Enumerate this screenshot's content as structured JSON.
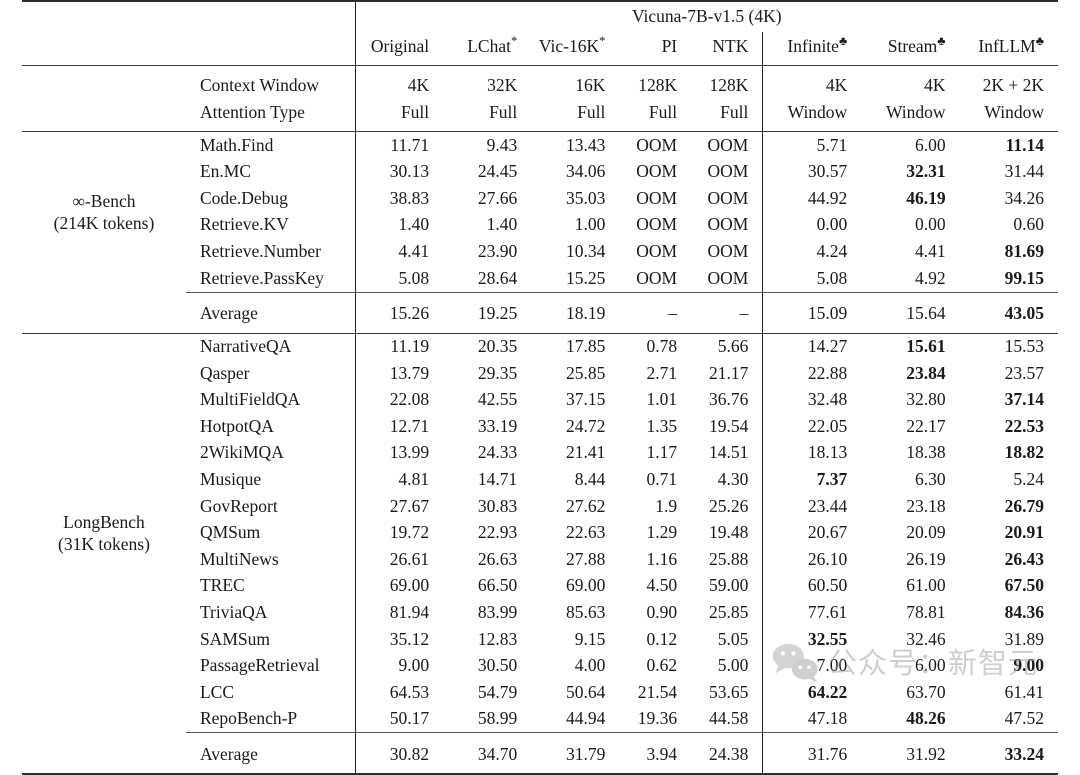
{
  "table": {
    "model_header": "Vicuna-7B-v1.5 (4K)",
    "methods": [
      {
        "label": "Original",
        "mark": ""
      },
      {
        "label": "LChat",
        "mark": "*"
      },
      {
        "label": "Vic-16K",
        "mark": "*"
      },
      {
        "label": "PI",
        "mark": ""
      },
      {
        "label": "NTK",
        "mark": ""
      },
      {
        "label": "Infinite",
        "mark": "♣"
      },
      {
        "label": "Stream",
        "mark": "♣"
      },
      {
        "label": "InfLLM",
        "mark": "♣"
      }
    ],
    "meta_rows": [
      {
        "label": "Context Window",
        "values": [
          "4K",
          "32K",
          "16K",
          "128K",
          "128K",
          "4K",
          "4K",
          "2K + 2K"
        ]
      },
      {
        "label": "Attention Type",
        "values": [
          "Full",
          "Full",
          "Full",
          "Full",
          "Full",
          "Window",
          "Window",
          "Window"
        ]
      }
    ],
    "sections": [
      {
        "group_name": "∞-Bench",
        "group_sub": "(214K tokens)",
        "rows": [
          {
            "task": "Math.Find",
            "values": [
              "11.71",
              "9.43",
              "13.43",
              "OOM",
              "OOM",
              "5.71",
              "6.00",
              "11.14"
            ],
            "bold": [
              false,
              false,
              false,
              false,
              false,
              false,
              false,
              true
            ]
          },
          {
            "task": "En.MC",
            "values": [
              "30.13",
              "24.45",
              "34.06",
              "OOM",
              "OOM",
              "30.57",
              "32.31",
              "31.44"
            ],
            "bold": [
              false,
              false,
              false,
              false,
              false,
              false,
              true,
              false
            ]
          },
          {
            "task": "Code.Debug",
            "values": [
              "38.83",
              "27.66",
              "35.03",
              "OOM",
              "OOM",
              "44.92",
              "46.19",
              "34.26"
            ],
            "bold": [
              false,
              false,
              false,
              false,
              false,
              false,
              true,
              false
            ]
          },
          {
            "task": "Retrieve.KV",
            "values": [
              "1.40",
              "1.40",
              "1.00",
              "OOM",
              "OOM",
              "0.00",
              "0.00",
              "0.60"
            ],
            "bold": [
              false,
              false,
              false,
              false,
              false,
              false,
              false,
              false
            ]
          },
          {
            "task": "Retrieve.Number",
            "values": [
              "4.41",
              "23.90",
              "10.34",
              "OOM",
              "OOM",
              "4.24",
              "4.41",
              "81.69"
            ],
            "bold": [
              false,
              false,
              false,
              false,
              false,
              false,
              false,
              true
            ]
          },
          {
            "task": "Retrieve.PassKey",
            "values": [
              "5.08",
              "28.64",
              "15.25",
              "OOM",
              "OOM",
              "5.08",
              "4.92",
              "99.15"
            ],
            "bold": [
              false,
              false,
              false,
              false,
              false,
              false,
              false,
              true
            ]
          }
        ],
        "average": {
          "task": "Average",
          "values": [
            "15.26",
            "19.25",
            "18.19",
            "–",
            "–",
            "15.09",
            "15.64",
            "43.05"
          ],
          "bold": [
            false,
            false,
            false,
            false,
            false,
            false,
            false,
            true
          ]
        }
      },
      {
        "group_name": "LongBench",
        "group_sub": "(31K tokens)",
        "rows": [
          {
            "task": "NarrativeQA",
            "values": [
              "11.19",
              "20.35",
              "17.85",
              "0.78",
              "5.66",
              "14.27",
              "15.61",
              "15.53"
            ],
            "bold": [
              false,
              false,
              false,
              false,
              false,
              false,
              true,
              false
            ]
          },
          {
            "task": "Qasper",
            "values": [
              "13.79",
              "29.35",
              "25.85",
              "2.71",
              "21.17",
              "22.88",
              "23.84",
              "23.57"
            ],
            "bold": [
              false,
              false,
              false,
              false,
              false,
              false,
              true,
              false
            ]
          },
          {
            "task": "MultiFieldQA",
            "values": [
              "22.08",
              "42.55",
              "37.15",
              "1.01",
              "36.76",
              "32.48",
              "32.80",
              "37.14"
            ],
            "bold": [
              false,
              false,
              false,
              false,
              false,
              false,
              false,
              true
            ]
          },
          {
            "task": "HotpotQA",
            "values": [
              "12.71",
              "33.19",
              "24.72",
              "1.35",
              "19.54",
              "22.05",
              "22.17",
              "22.53"
            ],
            "bold": [
              false,
              false,
              false,
              false,
              false,
              false,
              false,
              true
            ]
          },
          {
            "task": "2WikiMQA",
            "values": [
              "13.99",
              "24.33",
              "21.41",
              "1.17",
              "14.51",
              "18.13",
              "18.38",
              "18.82"
            ],
            "bold": [
              false,
              false,
              false,
              false,
              false,
              false,
              false,
              true
            ]
          },
          {
            "task": "Musique",
            "values": [
              "4.81",
              "14.71",
              "8.44",
              "0.71",
              "4.30",
              "7.37",
              "6.30",
              "5.24"
            ],
            "bold": [
              false,
              false,
              false,
              false,
              false,
              true,
              false,
              false
            ]
          },
          {
            "task": "GovReport",
            "values": [
              "27.67",
              "30.83",
              "27.62",
              "1.9",
              "25.26",
              "23.44",
              "23.18",
              "26.79"
            ],
            "bold": [
              false,
              false,
              false,
              false,
              false,
              false,
              false,
              true
            ]
          },
          {
            "task": "QMSum",
            "values": [
              "19.72",
              "22.93",
              "22.63",
              "1.29",
              "19.48",
              "20.67",
              "20.09",
              "20.91"
            ],
            "bold": [
              false,
              false,
              false,
              false,
              false,
              false,
              false,
              true
            ]
          },
          {
            "task": "MultiNews",
            "values": [
              "26.61",
              "26.63",
              "27.88",
              "1.16",
              "25.88",
              "26.10",
              "26.19",
              "26.43"
            ],
            "bold": [
              false,
              false,
              false,
              false,
              false,
              false,
              false,
              true
            ]
          },
          {
            "task": "TREC",
            "values": [
              "69.00",
              "66.50",
              "69.00",
              "4.50",
              "59.00",
              "60.50",
              "61.00",
              "67.50"
            ],
            "bold": [
              false,
              false,
              false,
              false,
              false,
              false,
              false,
              true
            ]
          },
          {
            "task": "TriviaQA",
            "values": [
              "81.94",
              "83.99",
              "85.63",
              "0.90",
              "25.85",
              "77.61",
              "78.81",
              "84.36"
            ],
            "bold": [
              false,
              false,
              false,
              false,
              false,
              false,
              false,
              true
            ]
          },
          {
            "task": "SAMSum",
            "values": [
              "35.12",
              "12.83",
              "9.15",
              "0.12",
              "5.05",
              "32.55",
              "32.46",
              "31.89"
            ],
            "bold": [
              false,
              false,
              false,
              false,
              false,
              true,
              false,
              false
            ]
          },
          {
            "task": "PassageRetrieval",
            "values": [
              "9.00",
              "30.50",
              "4.00",
              "0.62",
              "5.00",
              "7.00",
              "6.00",
              "9.00"
            ],
            "bold": [
              false,
              false,
              false,
              false,
              false,
              false,
              false,
              true
            ]
          },
          {
            "task": "LCC",
            "values": [
              "64.53",
              "54.79",
              "50.64",
              "21.54",
              "53.65",
              "64.22",
              "63.70",
              "61.41"
            ],
            "bold": [
              false,
              false,
              false,
              false,
              false,
              true,
              false,
              false
            ]
          },
          {
            "task": "RepoBench-P",
            "values": [
              "50.17",
              "58.99",
              "44.94",
              "19.36",
              "44.58",
              "47.18",
              "48.26",
              "47.52"
            ],
            "bold": [
              false,
              false,
              false,
              false,
              false,
              false,
              true,
              false
            ]
          }
        ],
        "average": {
          "task": "Average",
          "values": [
            "30.82",
            "34.70",
            "31.79",
            "3.94",
            "24.38",
            "31.76",
            "31.92",
            "33.24"
          ],
          "bold": [
            false,
            false,
            false,
            false,
            false,
            false,
            false,
            true
          ]
        }
      }
    ]
  },
  "watermark": {
    "text": "公众号：新智元"
  }
}
